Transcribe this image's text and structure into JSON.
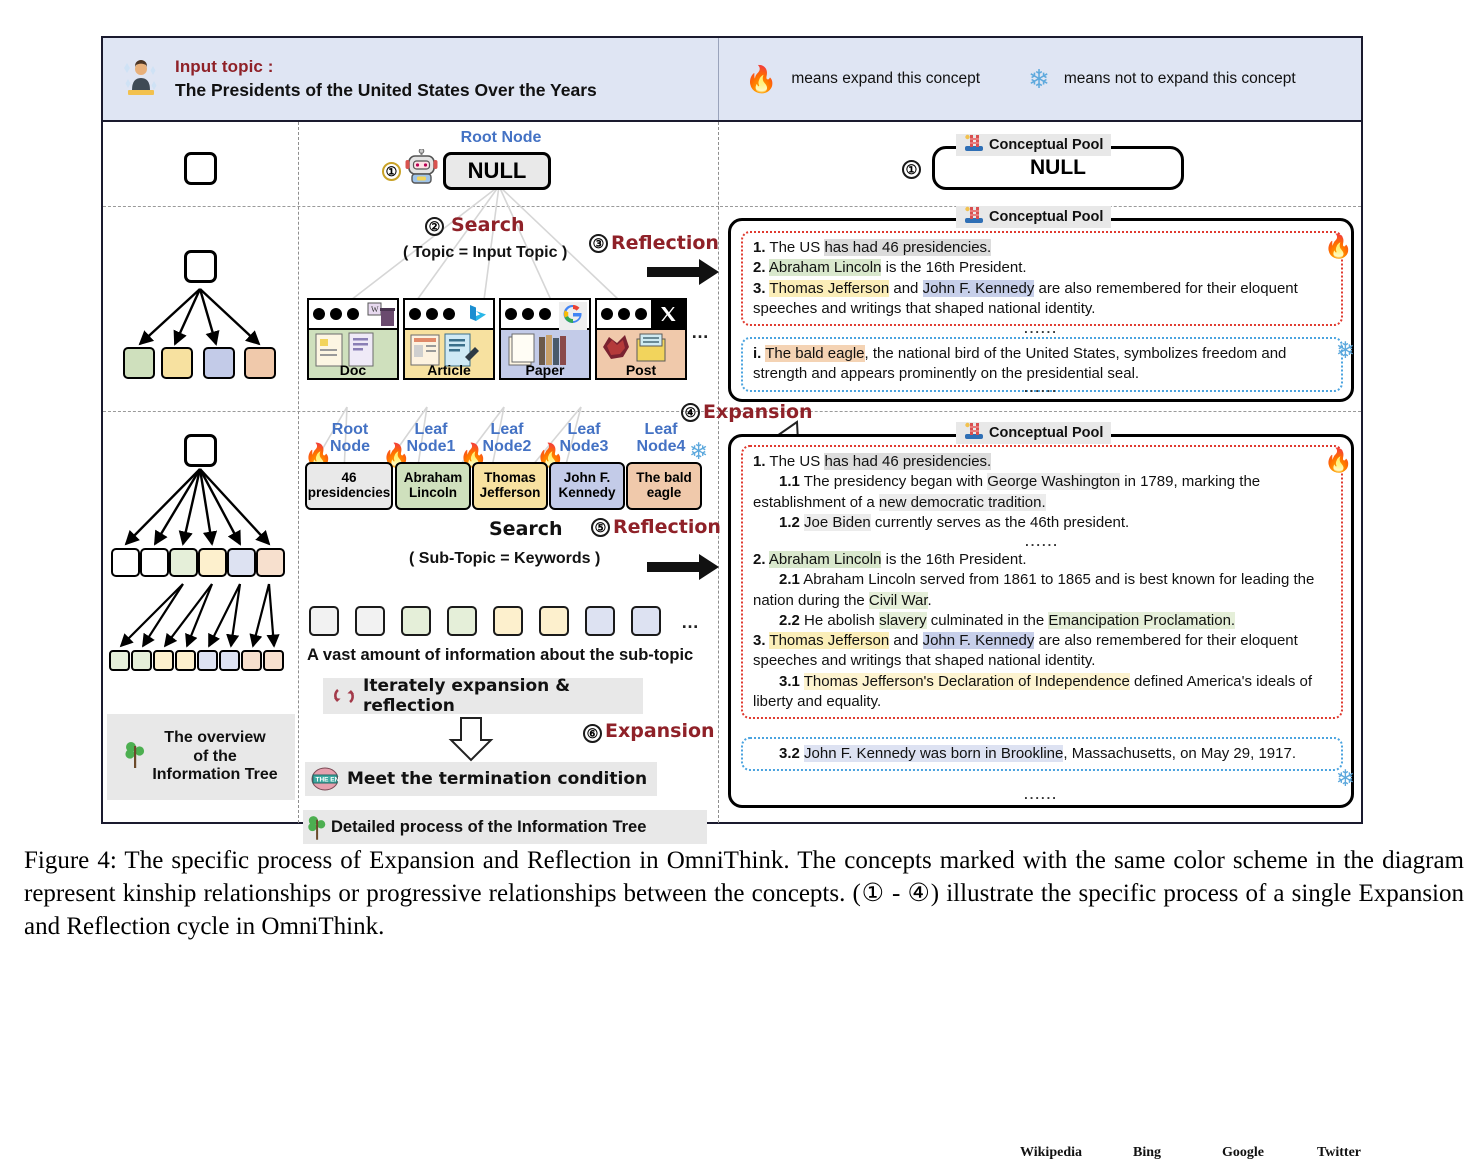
{
  "header": {
    "topic_label": "Input topic :",
    "topic_value": "The Presidents of the United States Over the Years",
    "person_icon": "person-at-desk-icon",
    "legend": [
      {
        "glyph": "🔥",
        "icon": "flame-icon",
        "text": "means expand this concept"
      },
      {
        "glyph": "❄",
        "icon": "snowflake-icon",
        "text": "means not to expand this concept"
      }
    ]
  },
  "middle": {
    "root_node_label": "Root Node",
    "root_node_value": "NULL",
    "step1": "①",
    "step2": "②",
    "step3": "③",
    "step4": "④",
    "step5": "⑤",
    "step6": "⑥",
    "search_label": "Search",
    "search_args_top": "( Topic = Input Topic )",
    "search_args_bottom": "( Sub-Topic = Keywords )",
    "reflection_label": "Reflection",
    "expansion_label": "Expansion",
    "robot_icon": "robot-icon",
    "sources": [
      {
        "name": "Doc",
        "site": "Wikipedia",
        "color": "#cfe0bd",
        "logo": "wikipedia-logo-icon"
      },
      {
        "name": "Article",
        "site": "Bing",
        "color": "#f7e1a0",
        "logo": "bing-logo-icon"
      },
      {
        "name": "Paper",
        "site": "Google",
        "color": "#c3cbe8",
        "logo": "google-logo-icon"
      },
      {
        "name": "Post",
        "site": "Twitter",
        "color": "#f0c9ab",
        "logo": "x-twitter-logo-icon"
      }
    ],
    "sources_more": "…",
    "tree_nodes": [
      {
        "title": "Root\nNode",
        "title1": "Root",
        "title2": "Node",
        "value": "46 presidencies",
        "v1": "46",
        "v2": "presidencies",
        "color": "#e9e9e9",
        "mark": "🔥"
      },
      {
        "title1": "Leaf",
        "title2": "Node1",
        "v1": "Abraham",
        "v2": "Lincoln",
        "color": "#cfe0bd",
        "mark": "🔥"
      },
      {
        "title1": "Leaf",
        "title2": "Node2",
        "v1": "Thomas",
        "v2": "Jefferson",
        "color": "#f7e1a0",
        "mark": "🔥"
      },
      {
        "title1": "Leaf",
        "title2": "Node3",
        "v1": "John F.",
        "v2": "Kennedy",
        "color": "#c3cbe8",
        "mark": "🔥"
      },
      {
        "title1": "Leaf",
        "title2": "Node4",
        "v1": "The bald",
        "v2": "eagle",
        "color": "#f0c9ab",
        "mark": "❄"
      }
    ],
    "chips_colors": [
      "#f2f2f2",
      "#f2f2f2",
      "#e5efd9",
      "#e5efd9",
      "#fdf0cd",
      "#fdf0cd",
      "#dde2f2",
      "#dde2f2"
    ],
    "chips_more": "…",
    "vast_info_label": "A vast amount of information about the sub-topic",
    "iterate_label": "Iterately expansion & reflection",
    "iterate_icon": "refresh-cycle-icon",
    "terminate_label": "Meet the termination condition",
    "terminate_icon": "the-end-icon",
    "detailed_legend": "Detailed process of the Information Tree",
    "detailed_legend_icon": "tree-icon"
  },
  "left": {
    "overview_legend_line1": "The overview",
    "overview_legend_line2": "of the",
    "overview_legend_line3": "Information Tree",
    "overview_legend_icon": "tree-icon",
    "row1_root": {
      "color": "#ffffff"
    },
    "row2_root": {
      "color": "#ffffff"
    },
    "row2_children": [
      "#cfe0bd",
      "#f7e1a0",
      "#c3cbe8",
      "#f0c9ab"
    ],
    "row3_root": {
      "color": "#ffffff"
    },
    "row3_children": [
      "#ffffff",
      "#ffffff",
      "#e5efd9",
      "#fdf0cd",
      "#dde2f2",
      "#f7e0ce"
    ],
    "row3_grandchildren": [
      "#e5efd9",
      "#e5efd9",
      "#fdf0cd",
      "#fdf0cd",
      "#dde2f2",
      "#dde2f2",
      "#f7e0ce",
      "#f7e0ce"
    ]
  },
  "pools": {
    "title": "Conceptual Pool",
    "ladder_icon": "ladder-pool-icon",
    "pool1": {
      "step": "①",
      "value": "NULL"
    },
    "pool2": {
      "red_block": [
        {
          "num": "1.",
          "segments": [
            {
              "t": " The US ",
              "hl": ""
            },
            {
              "t": "has had 46 presidencies.",
              "hl": "hl-grey"
            }
          ]
        },
        {
          "num": "2.",
          "segments": [
            {
              "t": " ",
              "hl": ""
            },
            {
              "t": "Abraham Lincoln",
              "hl": "hl-green"
            },
            {
              "t": " is the 16th President.",
              "hl": ""
            }
          ]
        },
        {
          "num": "3.",
          "segments": [
            {
              "t": " ",
              "hl": ""
            },
            {
              "t": "Thomas Jefferson",
              "hl": "hl-yellow"
            },
            {
              "t": " and ",
              "hl": ""
            },
            {
              "t": "John F. Kennedy",
              "hl": "hl-blue"
            },
            {
              "t": " are also remembered for their eloquent speeches and writings that shaped national identity.",
              "hl": ""
            }
          ]
        }
      ],
      "dots_mid": "......",
      "blue_block": [
        {
          "num": "i.",
          "segments": [
            {
              "t": " ",
              "hl": ""
            },
            {
              "t": "The bald eagle",
              "hl": "hl-orange"
            },
            {
              "t": ", the national bird of the United States, symbolizes freedom and strength and appears prominently on the presidential seal.",
              "hl": ""
            }
          ]
        }
      ],
      "dots_end": "......",
      "flame": "🔥",
      "snow": "❄"
    },
    "pool3": {
      "red_lines": [
        {
          "num": "1.",
          "indent": 0,
          "segments": [
            {
              "t": " The US ",
              "hl": ""
            },
            {
              "t": "has had 46 presidencies.",
              "hl": "hl-grey"
            }
          ]
        },
        {
          "num": "1.1",
          "indent": 1,
          "segments": [
            {
              "t": " The presidency began with ",
              "hl": ""
            },
            {
              "t": "George Washington",
              "hl": "hl-grey2"
            },
            {
              "t": " in 1789, marking the establishment of a ",
              "hl": ""
            },
            {
              "t": "new democratic tradition.",
              "hl": "hl-grey2"
            }
          ]
        },
        {
          "num": "1.2",
          "indent": 1,
          "segments": [
            {
              "t": " ",
              "hl": ""
            },
            {
              "t": "Joe Biden",
              "hl": "hl-grey2"
            },
            {
              "t": " currently serves as the 46th president.",
              "hl": ""
            }
          ]
        },
        {
          "num": "",
          "indent": 0,
          "dots": "......"
        },
        {
          "num": "2.",
          "indent": 0,
          "segments": [
            {
              "t": " ",
              "hl": ""
            },
            {
              "t": "Abraham Lincoln",
              "hl": "hl-green"
            },
            {
              "t": " is the 16th President.",
              "hl": ""
            }
          ]
        },
        {
          "num": "2.1",
          "indent": 1,
          "segments": [
            {
              "t": " Abraham Lincoln served from 1861 to 1865 and is best known for leading the nation during the ",
              "hl": ""
            },
            {
              "t": "Civil War",
              "hl": "hl-green-l"
            },
            {
              "t": ".",
              "hl": ""
            }
          ]
        },
        {
          "num": "2.2",
          "indent": 1,
          "segments": [
            {
              "t": " He abolish ",
              "hl": ""
            },
            {
              "t": "slavery",
              "hl": "hl-green-l"
            },
            {
              "t": " culminated in the ",
              "hl": ""
            },
            {
              "t": "Emancipation Proclamation.",
              "hl": "hl-green-l"
            }
          ]
        },
        {
          "num": "3.",
          "indent": 0,
          "segments": [
            {
              "t": " ",
              "hl": ""
            },
            {
              "t": "Thomas Jefferson",
              "hl": "hl-yellow"
            },
            {
              "t": " and ",
              "hl": ""
            },
            {
              "t": "John F. Kennedy",
              "hl": "hl-blue"
            },
            {
              "t": " are also remembered for their eloquent speeches and writings that shaped national identity.",
              "hl": ""
            }
          ]
        },
        {
          "num": "3.1",
          "indent": 1,
          "segments": [
            {
              "t": " ",
              "hl": ""
            },
            {
              "t": "Thomas Jefferson's Declaration of Independence",
              "hl": "hl-yellow-l"
            },
            {
              "t": " defined America's ideals of liberty and equality.",
              "hl": ""
            }
          ]
        }
      ],
      "blue_lines": [
        {
          "num": "3.2",
          "indent": 1,
          "segments": [
            {
              "t": " ",
              "hl": ""
            },
            {
              "t": "John F. Kennedy was born in Brookline",
              "hl": "hl-blue-l"
            },
            {
              "t": ", Massachusetts, on May 29, 1917.",
              "hl": ""
            }
          ]
        }
      ],
      "dots_end": "......",
      "flame": "🔥",
      "snow": "❄"
    }
  },
  "caption": {
    "text": "Figure 4: The specific process of Expansion and Reflection in OmniThink.  The concepts marked with the same color scheme in the diagram represent kinship relationships or progressive relationships between the concepts. (① - ④) illustrate the specific process of a single Expansion and Reflection cycle in OmniThink."
  },
  "colors": {
    "accent_red": "#8f2128",
    "accent_blue": "#4472c4",
    "header_bg": "#dfe5f3",
    "flame": "#e8522a",
    "snow": "#5ea9dd"
  }
}
